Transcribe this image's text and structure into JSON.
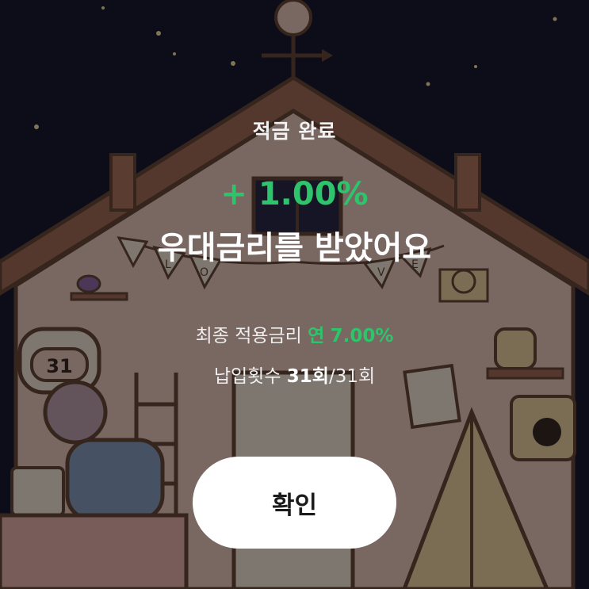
{
  "header": {
    "title": "적금 완료"
  },
  "reward": {
    "rate": "+ 1.00%",
    "message": "우대금리를 받았어요"
  },
  "summary": {
    "final_rate_label": "최종 적용금리",
    "final_rate_prefix": "연",
    "final_rate_value": "7.00%",
    "payment_label": "납입횟수",
    "payment_count": "31회",
    "payment_total": "/31회"
  },
  "illustration": {
    "calendar_day": "31",
    "banner_letters": [
      "L",
      "O",
      "V",
      "E"
    ]
  },
  "button": {
    "confirm_label": "확인"
  },
  "colors": {
    "accent_green": "#2ec46b",
    "night_sky": "#1a1a32",
    "house_wall": "#f3cfc5",
    "house_outline": "#6a4a3a",
    "button_bg": "#ffffff",
    "overlay": "rgba(0,0,0,0.5)"
  }
}
